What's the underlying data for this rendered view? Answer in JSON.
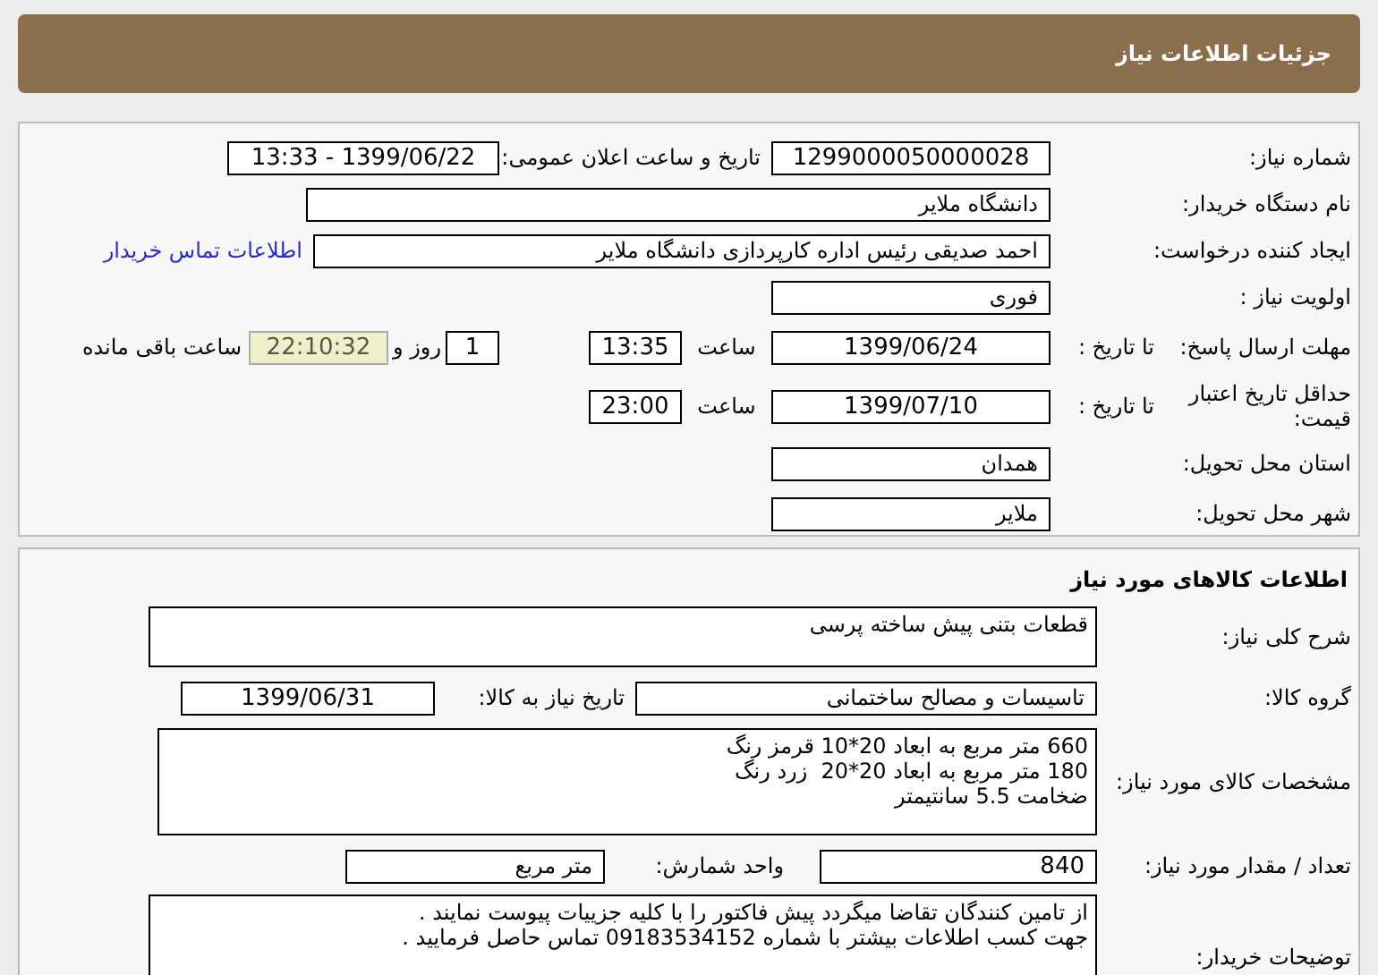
{
  "header": {
    "title": "جزئیات اطلاعات نیاز"
  },
  "need": {
    "number_label": "شماره نیاز:",
    "number": "1299000050000028",
    "announce_label": "تاریخ و ساعت اعلان عمومی:",
    "announce": "1399/06/22 - 13:33",
    "buyer_label": "نام دستگاه خریدار:",
    "buyer": "دانشگاه ملایر",
    "creator_label": "ایجاد کننده درخواست:",
    "creator": "احمد صدیقی رئیس اداره کارپردازی دانشگاه ملایر",
    "contact_link": "اطلاعات تماس خریدار",
    "priority_label": "اولویت نیاز :",
    "priority": "فوری",
    "deadline_label": "مهلت ارسال پاسخ:",
    "deadline_to": "تا تاریخ :",
    "deadline_date": "1399/06/24",
    "deadline_time_label": "ساعت",
    "deadline_time": "13:35",
    "days": "1",
    "days_label": "روز و",
    "remaining": "22:10:32",
    "remaining_label": "ساعت باقی مانده",
    "validity_label": "حداقل تاریخ اعتبار قیمت:",
    "validity_to": "تا تاریخ :",
    "validity_date": "1399/07/10",
    "validity_time_label": "ساعت",
    "validity_time": "23:00",
    "province_label": "استان محل تحویل:",
    "province": "همدان",
    "city_label": "شهر محل تحویل:",
    "city": "ملایر"
  },
  "goods": {
    "title": "اطلاعات کالاهای مورد نیاز",
    "summary_label": "شرح کلی نیاز:",
    "summary": "قطعات بتنی پیش ساخته پرسی",
    "group_label": "گروه کالا:",
    "group": "تاسیسات و مصالح ساختمانی",
    "need_date_label": "تاریخ نیاز به کالا:",
    "need_date": "1399/06/31",
    "specs_label": "مشخصات کالای مورد نیاز:",
    "specs": [
      "660 متر مربع به ابعاد 20*10 قرمز رنگ",
      "180 متر مربع به ابعاد 20*20  زرد رنگ",
      "ضخامت 5.5 سانتیمتر"
    ],
    "qty_label": "تعداد / مقدار مورد نیاز:",
    "qty": "840",
    "unit_label": "واحد شمارش:",
    "unit": "متر مربع",
    "notes_label": "توضیحات خریدار:",
    "notes": [
      "از تامین کنندگان تقاضا میگردد پیش فاکتور را با کلیه جزییات پیوست نمایند .",
      "جهت کسب اطلاعات بیشتر با شماره 09183534152 تماس حاصل فرمایید ."
    ]
  }
}
